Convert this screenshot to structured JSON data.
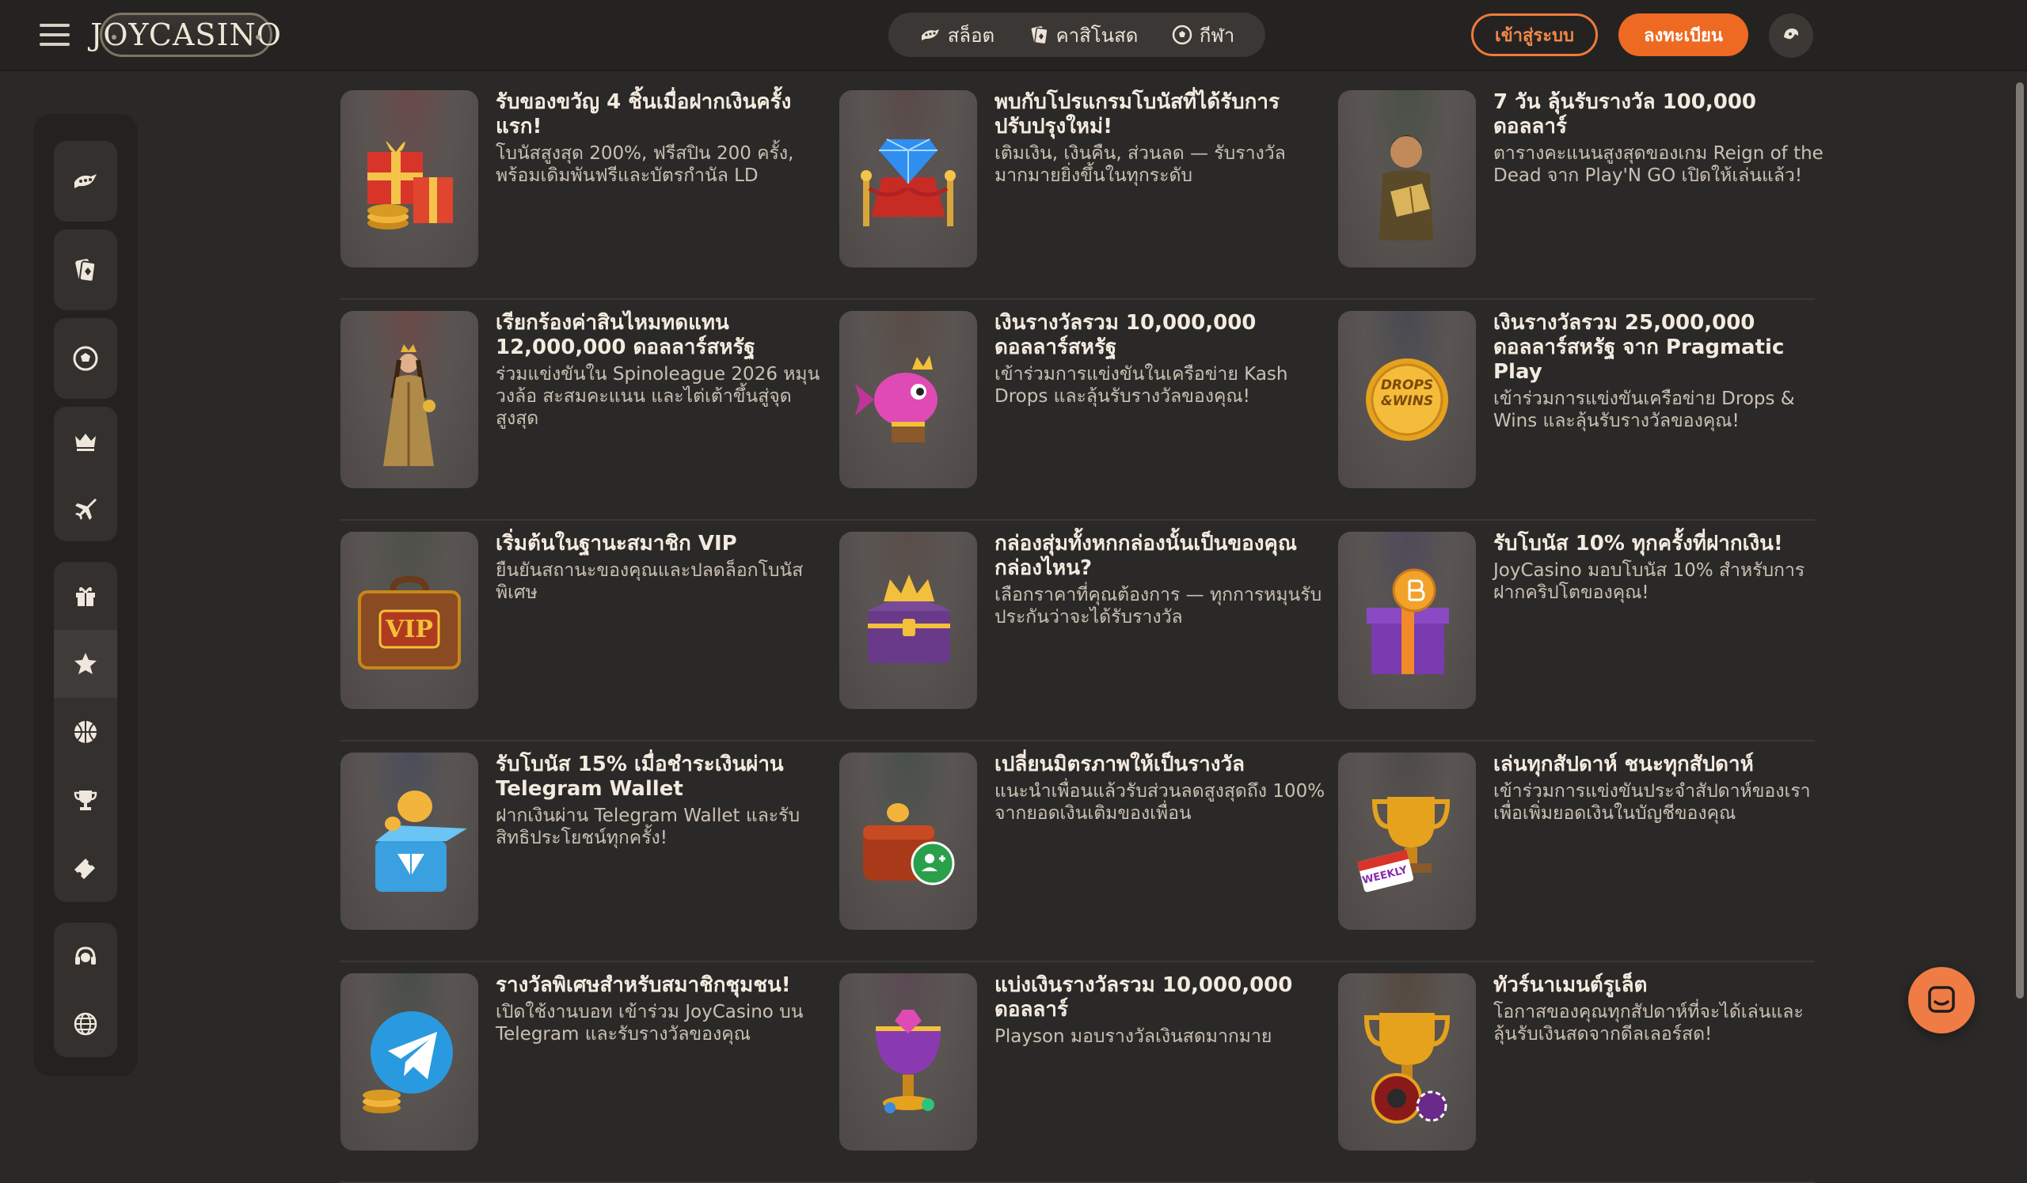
{
  "header": {
    "logo": "JOYCASINO",
    "nav": [
      {
        "label": "สล็อต",
        "icon": "slot-machine-icon"
      },
      {
        "label": "คาสิโนสด",
        "icon": "playing-cards-icon"
      },
      {
        "label": "กีฬา",
        "icon": "soccer-ball-icon"
      }
    ],
    "login_label": "เข้าสู่ระบบ",
    "register_label": "ลงทะเบียน",
    "language_icon": "globe-icon"
  },
  "sidebar": {
    "icons": [
      "slot-machine-icon",
      "playing-cards-icon",
      "soccer-ball-icon",
      "crown-icon",
      "airplane-icon",
      "gift-icon",
      "star-badge-icon",
      "basketball-icon",
      "trophy-icon",
      "ticket-icon",
      "support-headset-icon",
      "globe-icon"
    ]
  },
  "promotions": [
    {
      "title": "รับของขวัญ 4 ชิ้นเมื่อฝากเงินครั้งแรก!",
      "desc": "โบนัสสูงสุด 200%, ฟรีสปิน 200 ครั้ง, พร้อมเดิมพันฟรีและบัตรกำนัล LD",
      "image": "gift-boxes-coins",
      "glow": "#6a4a4a"
    },
    {
      "title": "พบกับโปรแกรมโบนัสที่ได้รับการปรับปรุงใหม่!",
      "desc": "เติมเงิน, เงินคืน, ส่วนลด — รับรางวัลมากมายยิ่งขึ้นในทุกระดับ",
      "image": "diamond-red-carpet",
      "glow": "#5a4a4a"
    },
    {
      "title": "7 วัน ลุ้นรับรางวัล 100,000 ดอลลาร์",
      "desc": "ตารางคะแนนสูงสุดของเกม Reign of the Dead จาก Play'N GO เปิดให้เล่นแล้ว!",
      "image": "adventurer-book",
      "glow": "#4a5048"
    },
    {
      "title": "เรียกร้องค่าสินไหมทดแทน 12,000,000 ดอลลาร์สหรัฐ",
      "desc": "ร่วมแข่งขันใน Spinoleague 2026 หมุนวงล้อ สะสมคะแนน และไต่เต้าขึ้นสู่จุดสูงสุด",
      "image": "queen-figure",
      "glow": "#6a4a48"
    },
    {
      "title": "เงินรางวัลรวม 10,000,000 ดอลลาร์สหรัฐ",
      "desc": "เข้าร่วมการแข่งขันในเครือข่าย Kash Drops และลุ้นรับรางวัลของคุณ!",
      "image": "pink-fish-crown",
      "glow": "#5a4c46"
    },
    {
      "title": "เงินรางวัลรวม 25,000,000 ดอลลาร์สหรัฐ จาก Pragmatic Play",
      "desc": "เข้าร่วมการแข่งขันเครือข่าย Drops & Wins และลุ้นรับรางวัลของคุณ!",
      "image": "drops-wins-coin",
      "glow": "#484a52",
      "coin_text": "DROPS &WINS"
    },
    {
      "title": "เริ่มต้นในฐานะสมาชิก VIP",
      "desc": "ยืนยันสถานะของคุณและปลดล็อกโบนัสพิเศษ",
      "image": "vip-suitcase",
      "glow": "#4e504a",
      "badge_text": "VIP"
    },
    {
      "title": "กล่องสุ่มทั้งหกกล่องนั้นเป็นของคุณ กล่องไหน?",
      "desc": "เลือกราคาที่คุณต้องการ — ทุกการหมุนรับประกันว่าจะได้รับรางวัล",
      "image": "treasure-chest-crown",
      "glow": "#5a4e4a"
    },
    {
      "title": "รับโบนัส 10% ทุกครั้งที่ฝากเงิน!",
      "desc": "JoyCasino มอบโบนัส 10% สำหรับการฝากคริปโตของคุณ!",
      "image": "bitcoin-gift",
      "glow": "#4e4a5a"
    },
    {
      "title": "รับโบนัส 15% เมื่อชำระเงินผ่าน Telegram Wallet",
      "desc": "ฝากเงินผ่าน Telegram Wallet และรับสิทธิประโยชน์ทุกครั้ง!",
      "image": "ton-coin-box",
      "glow": "#4a4e5a"
    },
    {
      "title": "เปลี่ยนมิตรภาพให้เป็นรางวัล",
      "desc": "แนะนำเพื่อนแล้วรับส่วนลดสูงสุดถึง 100% จากยอดเงินเติมของเพื่อน",
      "image": "wallet-add-friend",
      "glow": "#48504a"
    },
    {
      "title": "เล่นทุกสัปดาห์ ชนะทุกสัปดาห์",
      "desc": "เข้าร่วมการแข่งขันประจำสัปดาห์ของเราเพื่อเพิ่มยอดเงินในบัญชีของคุณ",
      "image": "weekly-trophy",
      "glow": "#4e4a48",
      "badge_text": "WEEKLY"
    },
    {
      "title": "รางวัลพิเศษสำหรับสมาชิกชุมชน!",
      "desc": "เปิดใช้งานบอท เข้าร่วม JoyCasino บน Telegram และรับรางวัลของคุณ",
      "image": "telegram-coins",
      "glow": "#484e48"
    },
    {
      "title": "แบ่งเงินรางวัลรวม 10,000,000 ดอลลาร์",
      "desc": "Playson มอบรางวัลเงินสดมากมาย",
      "image": "gem-goblet",
      "glow": "#5a4a52"
    },
    {
      "title": "ทัวร์นาเมนต์รูเล็ต",
      "desc": "โอกาสของคุณทุกสัปดาห์ที่จะได้เล่นและลุ้นรับเงินสดจากดีลเลอร์สด!",
      "image": "roulette-trophy",
      "glow": "#56483e"
    }
  ],
  "chat_icon": "chat-bubble-icon"
}
